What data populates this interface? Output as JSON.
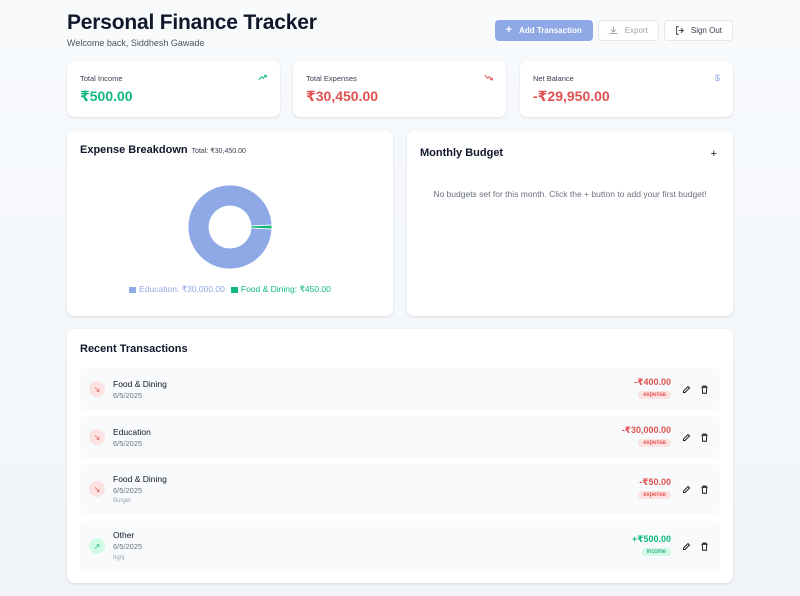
{
  "header": {
    "title": "Personal Finance Tracker",
    "subtitle": "Welcome back, Siddhesh Gawade"
  },
  "actions": {
    "add_label": "Add Transaction",
    "export_label": "Export",
    "signout_label": "Sign Out"
  },
  "stats": [
    {
      "label": "Total Income",
      "value": "₹500.00",
      "icon": "trending-up-icon"
    },
    {
      "label": "Total Expenses",
      "value": "₹30,450.00",
      "icon": "trending-down-icon"
    },
    {
      "label": "Net Balance",
      "value": "-₹29,950.00",
      "icon": "dollar-icon"
    }
  ],
  "breakdown": {
    "title": "Expense Breakdown",
    "total": "Total: ₹30,450.00",
    "legend": [
      {
        "label": "Education: ₹30,000.00",
        "color": "#8fa8e6"
      },
      {
        "label": "Food & Dining: ₹450.00",
        "color": "#10b981"
      }
    ]
  },
  "chart_data": {
    "type": "pie",
    "categories": [
      "Education",
      "Food & Dining"
    ],
    "values": [
      30000,
      450
    ],
    "colors": [
      "#8fa8e6",
      "#10b981"
    ]
  },
  "budget": {
    "title": "Monthly Budget",
    "add_symbol": "+",
    "empty_text": "No budgets set for this month. Click the + button to add your first budget!"
  },
  "transactions": {
    "title": "Recent Transactions",
    "items": [
      {
        "category": "Food & Dining",
        "date": "6/5/2025",
        "note": "",
        "amount": "-₹400.00",
        "type": "expense"
      },
      {
        "category": "Education",
        "date": "6/5/2025",
        "note": "",
        "amount": "-₹30,000.00",
        "type": "expense"
      },
      {
        "category": "Food & Dining",
        "date": "6/5/2025",
        "note": "Burger",
        "amount": "-₹50.00",
        "type": "expense"
      },
      {
        "category": "Other",
        "date": "6/5/2025",
        "note": "hgnj",
        "amount": "+₹500.00",
        "type": "income"
      }
    ]
  }
}
